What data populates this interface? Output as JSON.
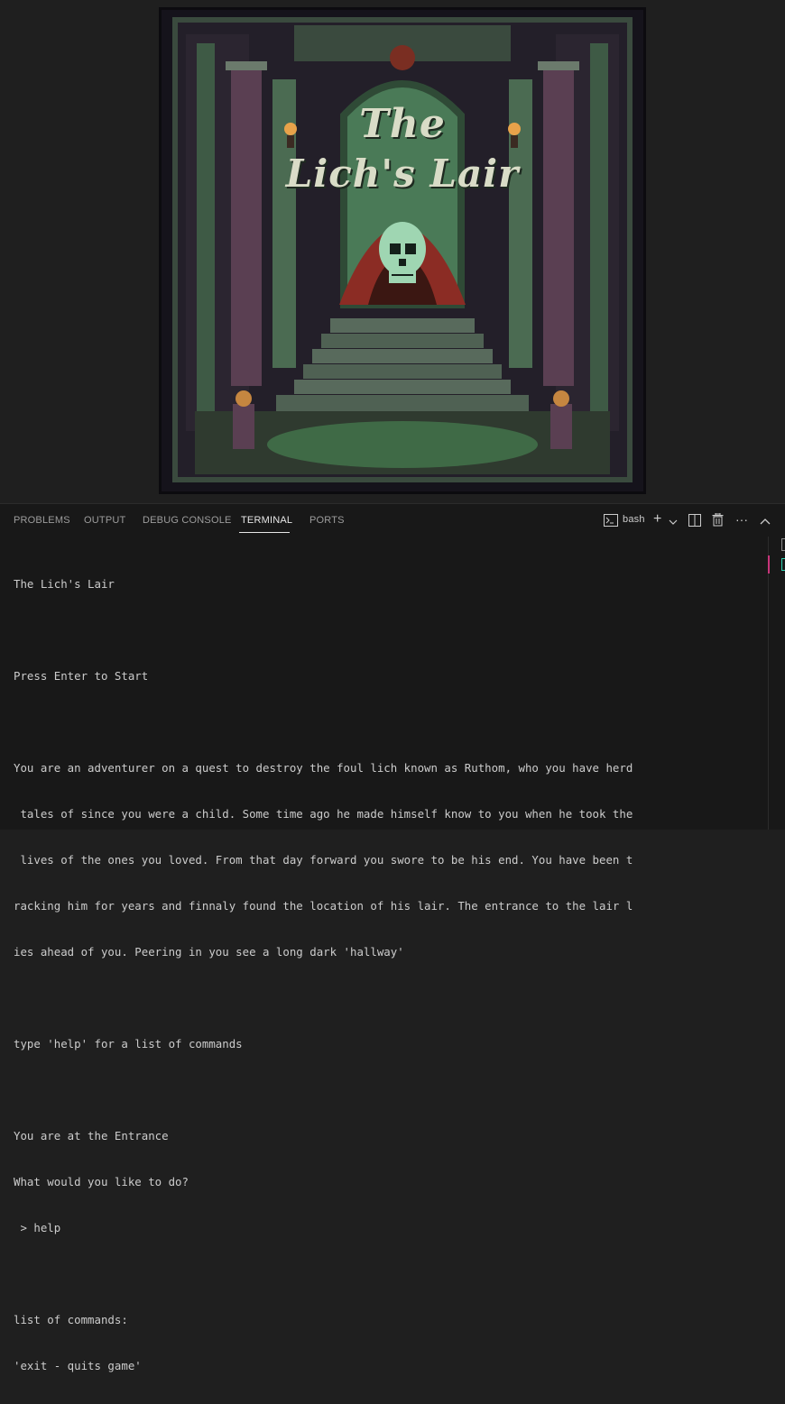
{
  "artwork": {
    "title_line1": "The",
    "title_line2": "Lich's Lair",
    "colors": {
      "panel_green": "#4a7a57",
      "stone": "#5d6b5f",
      "robe": "#8b2c24",
      "skull": "#9fd6b2"
    }
  },
  "panel": {
    "tabs": [
      {
        "label": "PROBLEMS"
      },
      {
        "label": "OUTPUT"
      },
      {
        "label": "DEBUG CONSOLE"
      },
      {
        "label": "TERMINAL",
        "active": true
      },
      {
        "label": "PORTS"
      }
    ],
    "shell_label": "bash",
    "icons": [
      "terminal-icon",
      "plus-icon",
      "chevron-down-icon",
      "split-icon",
      "trash-icon",
      "ellipsis-icon",
      "chevron-up-icon"
    ]
  },
  "terminal": {
    "lines": [
      "The Lich's Lair",
      "",
      "Press Enter to Start",
      "",
      "You are an adventurer on a quest to destroy the foul lich known as Ruthom, who you have herd",
      " tales of since you were a child. Some time ago he made himself know to you when he took the",
      " lives of the ones you loved. From that day forward you swore to be his end. You have been t",
      "racking him for years and finnaly found the location of his lair. The entrance to the lair l",
      "ies ahead of you. Peering in you see a long dark 'hallway'",
      "",
      "type 'help' for a list of commands",
      "",
      "You are at the Entrance",
      "What would you like to do?",
      " > help",
      "",
      "list of commands:",
      "'exit - quits game'"
    ]
  }
}
